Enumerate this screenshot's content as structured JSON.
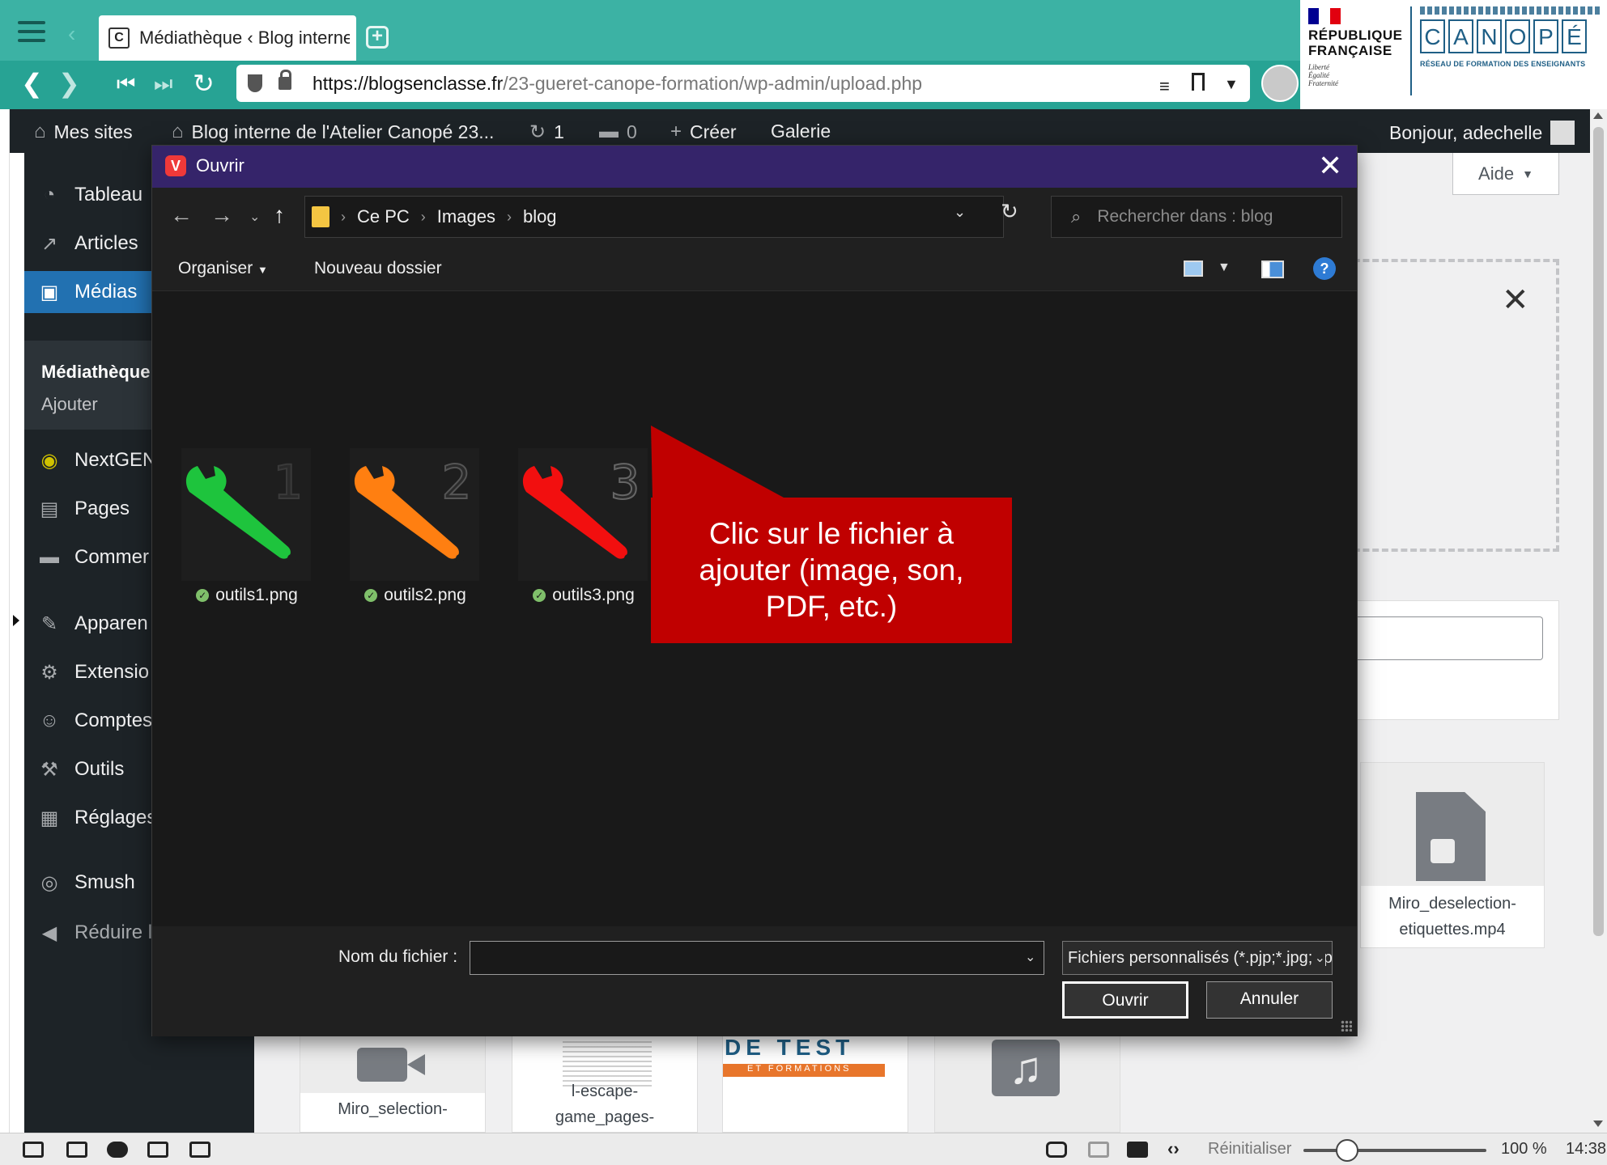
{
  "browser": {
    "tab_title": "Médiathèque ‹ Blog interne",
    "tab_favicon": "C",
    "url_host": "https://blogsenclasse.fr",
    "url_path": "/23-gueret-canope-formation/wp-admin/upload.php",
    "icons": [
      "hamburger-icon",
      "back-icon",
      "forward-icon",
      "rewind-icon",
      "fast-forward-icon",
      "reload-icon",
      "shield-icon",
      "lock-icon",
      "reader-icon",
      "bookmark-icon",
      "menu-icon",
      "profile-avatar"
    ]
  },
  "logos": {
    "republique": "RÉPUBLIQUE FRANÇAISE",
    "republique_line1": "RÉPUBLIQUE",
    "republique_line2": "FRANÇAISE",
    "motto_1": "Liberté",
    "motto_2": "Égalité",
    "motto_3": "Fraternité",
    "canope_letters": [
      "C",
      "A",
      "N",
      "O",
      "P",
      "É"
    ],
    "canope_tagline": "RÉSEAU DE FORMATION DES ENSEIGNANTS",
    "flag_colors": [
      "#000091",
      "#ffffff",
      "#e1000f"
    ]
  },
  "admin_bar": {
    "my_sites": "Mes sites",
    "site_name": "Blog interne de l'Atelier Canopé 23...",
    "updates_count": "1",
    "comments_count": "0",
    "new": "Créer",
    "gallery": "Galerie",
    "greeting": "Bonjour, adechelle"
  },
  "sidebar": {
    "dashboard": "Tableau",
    "articles": "Articles",
    "medias": "Médias",
    "library": "Médiathèque",
    "add": "Ajouter",
    "nextgen": "NextGEN",
    "pages": "Pages",
    "comments": "Commer",
    "appearance": "Apparen",
    "extensions": "Extensio",
    "accounts": "Comptes",
    "tools": "Outils",
    "settings": "Réglages",
    "smush": "Smush",
    "collapse": "Réduire l"
  },
  "content": {
    "help": "Aide",
    "video_name": "Miro_deselection-etiquettes.mp4",
    "video_name_line1": "Miro_deselection-",
    "video_name_line2": "etiquettes.mp4",
    "bottom_thumb_1": "Miro_selection-",
    "bottom_thumb_2_line1": "l-escape-",
    "bottom_thumb_2_line2": "game_pages-",
    "bottom_thumb_3_word": "DE TEST",
    "bottom_thumb_3_band": "ET FORMATIONS"
  },
  "dialog": {
    "title": "Ouvrir",
    "breadcrumb": [
      "Ce PC",
      "Images",
      "blog"
    ],
    "search_placeholder": "Rechercher dans : blog",
    "organize": "Organiser",
    "new_folder": "Nouveau dossier",
    "files": [
      {
        "name": "outils1.png",
        "number": "1",
        "color": "#1ec43d"
      },
      {
        "name": "outils2.png",
        "number": "2",
        "color": "#ff7f11"
      },
      {
        "name": "outils3.png",
        "number": "3",
        "color": "#f20f0f"
      }
    ],
    "filename_label": "Nom du fichier :",
    "filename_value": "",
    "filetype": "Fichiers personnalisés (*.pjp;*.jpg;*.png)",
    "open": "Ouvrir",
    "cancel": "Annuler",
    "accent_color": "#35246a"
  },
  "callout": {
    "text_line1": "Clic sur le fichier à",
    "text_line2": "ajouter (image, son,",
    "text_line3": "PDF, etc.)",
    "color": "#c00000"
  },
  "statusbar": {
    "reset": "Réinitialiser",
    "zoom": "100 %",
    "zoom_level": 0.2,
    "clock": "14:38"
  }
}
